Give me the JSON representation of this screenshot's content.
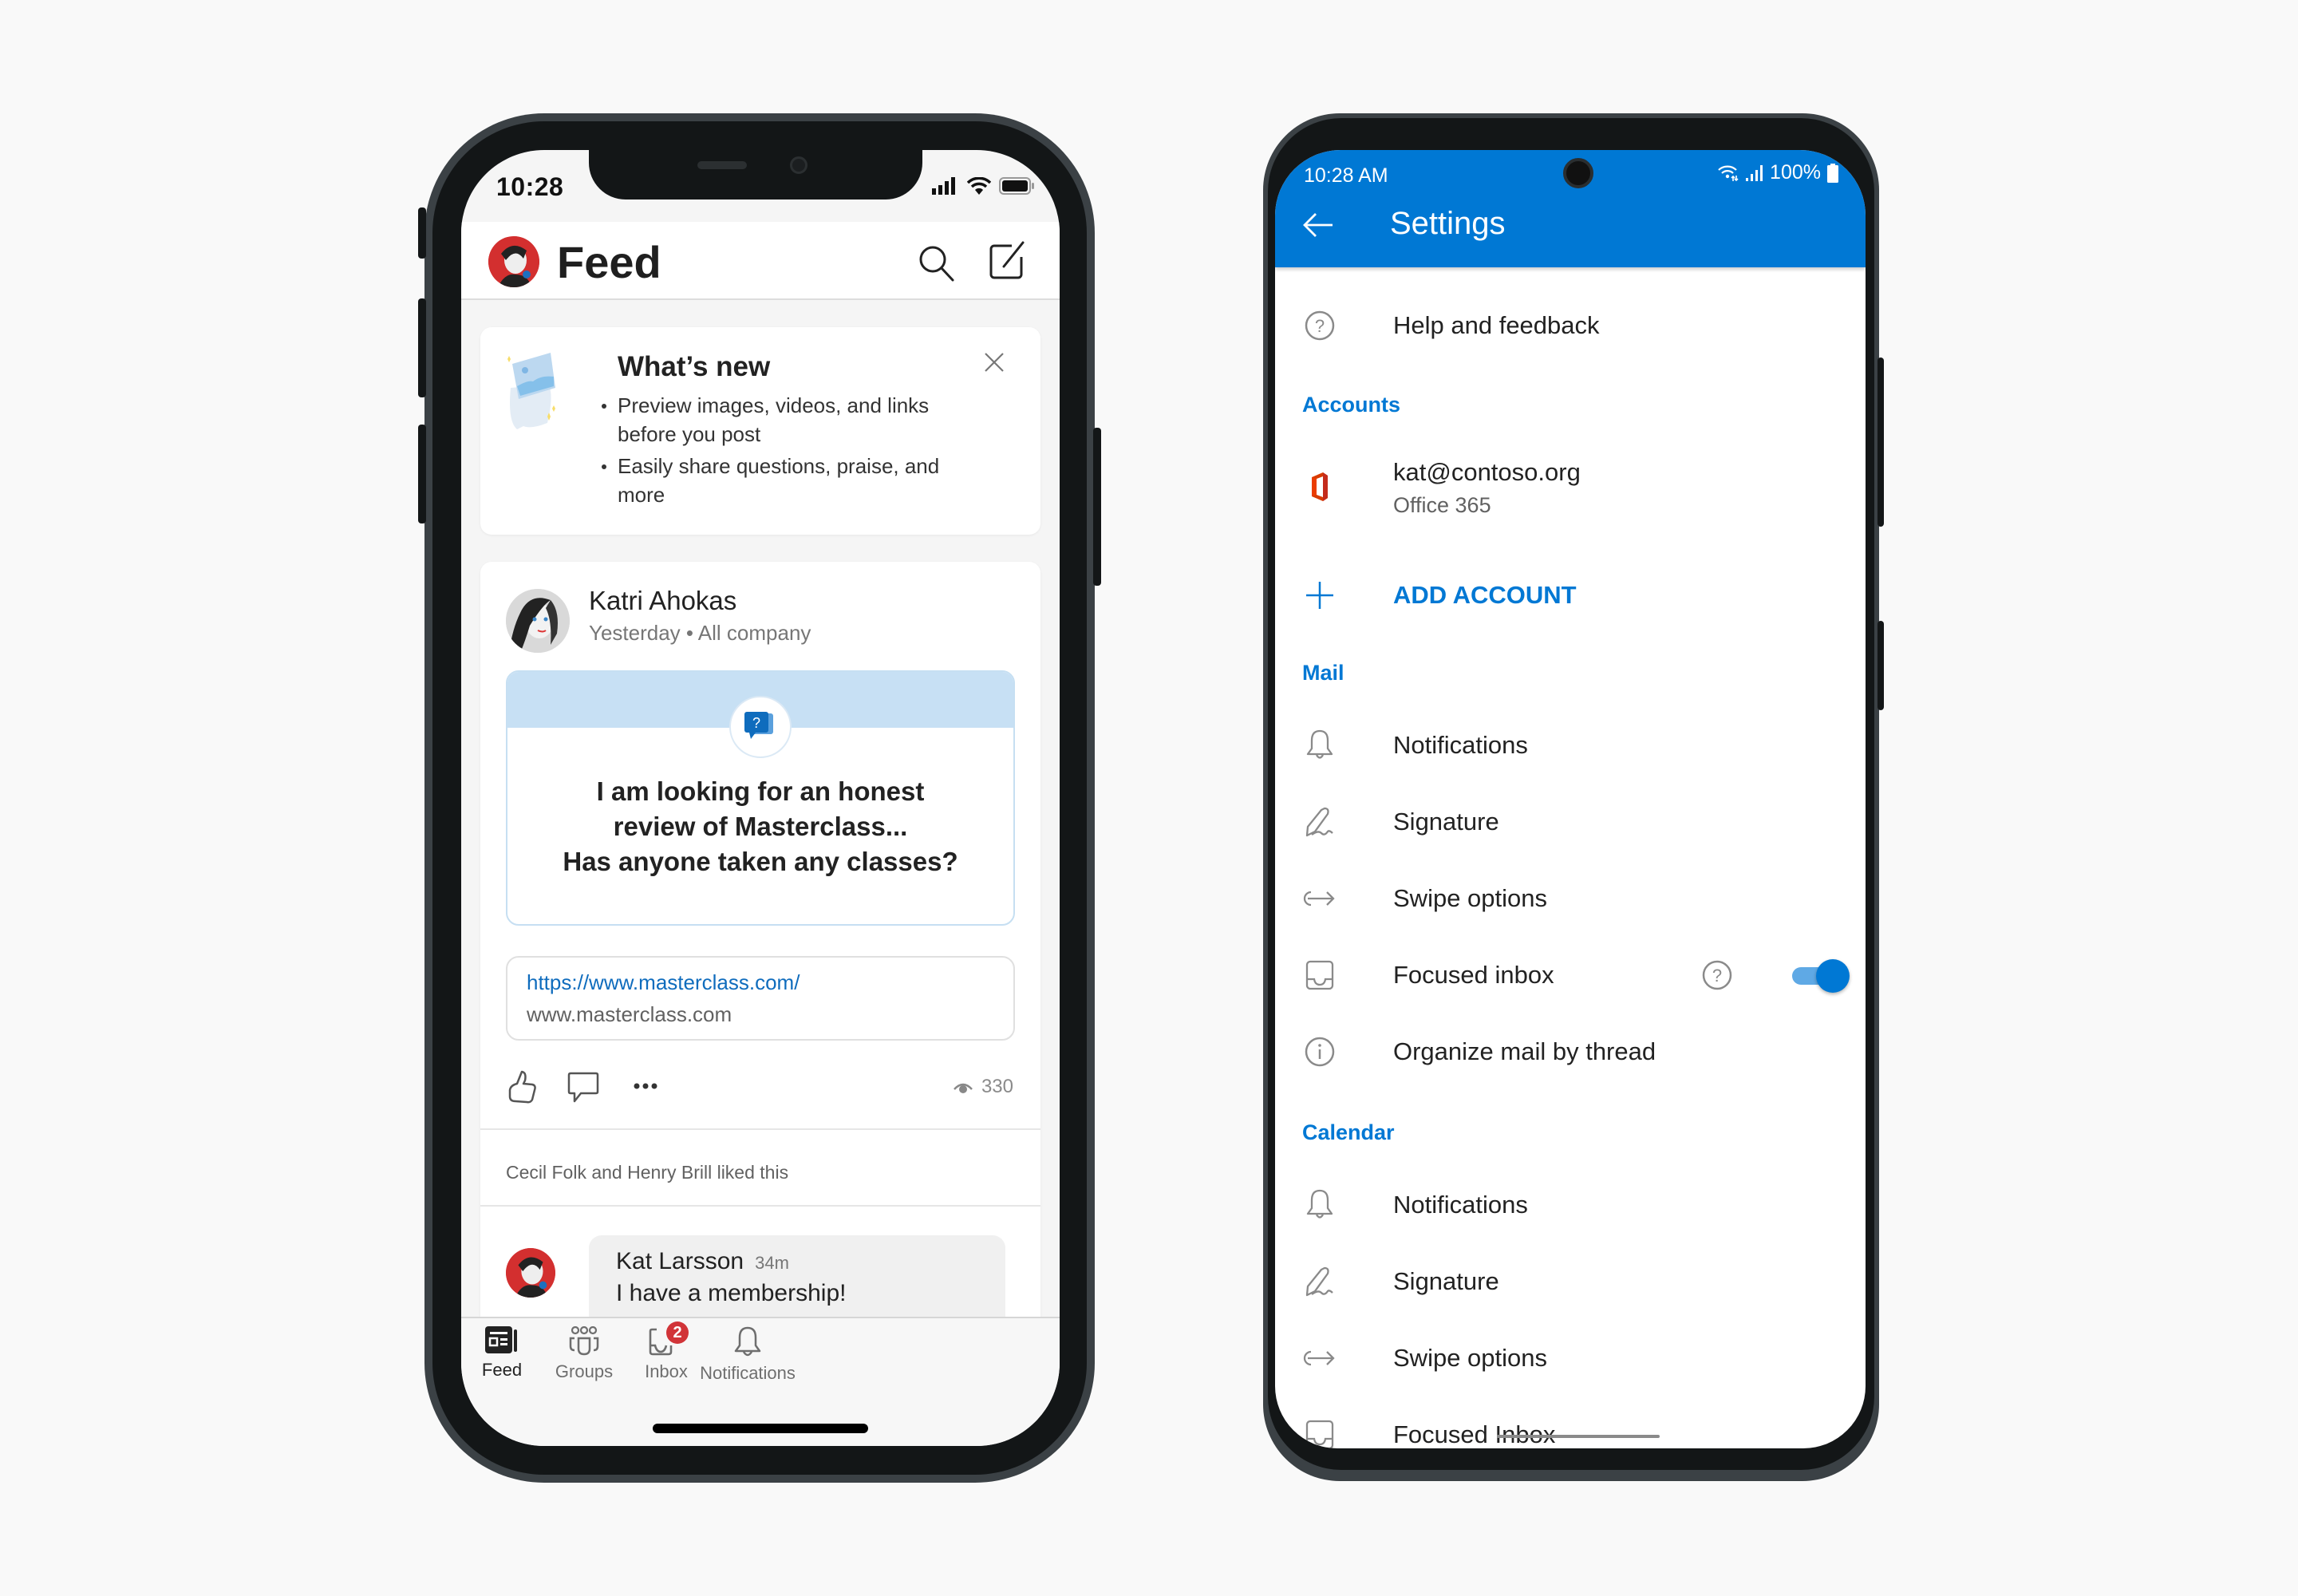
{
  "ios_phone": {
    "status_bar": {
      "time": "10:28"
    },
    "header": {
      "title": "Feed",
      "avatar": "user-avatar",
      "actions": [
        "search-icon",
        "compose-icon"
      ]
    },
    "whats_new": {
      "title": "What’s new",
      "items": [
        "Preview images, videos, and links before you post",
        "Easily share questions, praise, and more"
      ],
      "close_icon": "close-icon"
    },
    "post": {
      "author": "Katri Ahokas",
      "meta": "Yesterday • All company",
      "question_icon": "question-chat-icon",
      "question_text": [
        "I am looking for an honest",
        "review of Masterclass...",
        "Has anyone taken any classes?"
      ],
      "link": {
        "url": "https://www.masterclass.com/",
        "domain": "www.masterclass.com"
      },
      "actions": [
        "like-icon",
        "comment-icon",
        "more-icon"
      ],
      "views": "330",
      "liked_by": "Cecil Folk and Henry Brill liked this",
      "comment": {
        "author": "Kat Larsson",
        "time": "34m",
        "text": "I have a membership!"
      }
    },
    "tabbar": {
      "tabs": [
        {
          "label": "Feed",
          "icon": "feed-icon",
          "active": true
        },
        {
          "label": "Groups",
          "icon": "groups-icon",
          "active": false
        },
        {
          "label": "Inbox",
          "icon": "inbox-icon",
          "active": false,
          "badge": "2"
        },
        {
          "label": "Notifications",
          "icon": "bell-icon",
          "active": false
        }
      ]
    }
  },
  "android_phone": {
    "status_bar": {
      "time": "10:28 AM",
      "battery": "100%"
    },
    "header": {
      "title": "Settings",
      "back_icon": "back-arrow-icon"
    },
    "help": {
      "label": "Help and feedback"
    },
    "accounts": {
      "section_label": "Accounts",
      "account": {
        "email": "kat@contoso.org",
        "type": "Office 365"
      },
      "add_label": "ADD ACCOUNT"
    },
    "mail": {
      "section_label": "Mail",
      "items": [
        {
          "label": "Notifications",
          "icon": "bell-icon"
        },
        {
          "label": "Signature",
          "icon": "signature-icon"
        },
        {
          "label": "Swipe options",
          "icon": "swipe-icon"
        },
        {
          "label": "Focused inbox",
          "icon": "inbox-tray-icon",
          "toggle": true
        },
        {
          "label": "Organize mail by thread",
          "icon": "info-icon"
        }
      ]
    },
    "calendar": {
      "section_label": "Calendar",
      "items": [
        {
          "label": "Notifications",
          "icon": "bell-icon"
        },
        {
          "label": "Signature",
          "icon": "signature-icon"
        },
        {
          "label": "Swipe options",
          "icon": "swipe-icon"
        },
        {
          "label": "Focused Inbox",
          "icon": "inbox-tray-icon"
        }
      ]
    },
    "colors": {
      "accent": "#0078d4",
      "toggle_track": "#5fa9e5"
    }
  }
}
